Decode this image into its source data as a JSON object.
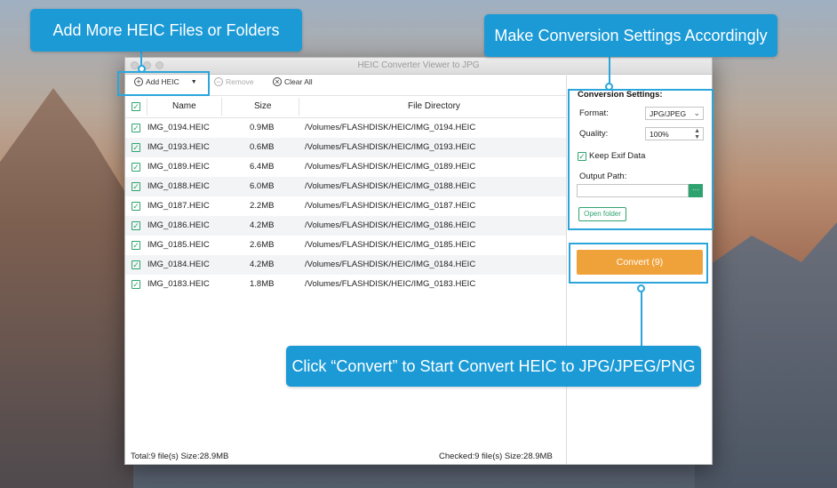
{
  "window": {
    "title": "HEIC Converter Viewer to JPG"
  },
  "toolbar": {
    "add_label": "Add HEIC",
    "remove_label": "Remove",
    "clear_label": "Clear All"
  },
  "table": {
    "headers": {
      "name": "Name",
      "size": "Size",
      "dir": "File Directory"
    },
    "rows": [
      {
        "name": "IMG_0194.HEIC",
        "size": "0.9MB",
        "dir": "/Volumes/FLASHDISK/HEIC/IMG_0194.HEIC"
      },
      {
        "name": "IMG_0193.HEIC",
        "size": "0.6MB",
        "dir": "/Volumes/FLASHDISK/HEIC/IMG_0193.HEIC"
      },
      {
        "name": "IMG_0189.HEIC",
        "size": "6.4MB",
        "dir": "/Volumes/FLASHDISK/HEIC/IMG_0189.HEIC"
      },
      {
        "name": "IMG_0188.HEIC",
        "size": "6.0MB",
        "dir": "/Volumes/FLASHDISK/HEIC/IMG_0188.HEIC"
      },
      {
        "name": "IMG_0187.HEIC",
        "size": "2.2MB",
        "dir": "/Volumes/FLASHDISK/HEIC/IMG_0187.HEIC"
      },
      {
        "name": "IMG_0186.HEIC",
        "size": "4.2MB",
        "dir": "/Volumes/FLASHDISK/HEIC/IMG_0186.HEIC"
      },
      {
        "name": "IMG_0185.HEIC",
        "size": "2.6MB",
        "dir": "/Volumes/FLASHDISK/HEIC/IMG_0185.HEIC"
      },
      {
        "name": "IMG_0184.HEIC",
        "size": "4.2MB",
        "dir": "/Volumes/FLASHDISK/HEIC/IMG_0184.HEIC"
      },
      {
        "name": "IMG_0183.HEIC",
        "size": "1.8MB",
        "dir": "/Volumes/FLASHDISK/HEIC/IMG_0183.HEIC"
      }
    ]
  },
  "status": {
    "total": "Total:9 file(s) Size:28.9MB",
    "checked": "Checked:9 file(s) Size:28.9MB"
  },
  "settings": {
    "title": "Conversion Settings:",
    "format_label": "Format:",
    "format_value": "JPG/JPEG",
    "quality_label": "Quality:",
    "quality_value": "100%",
    "exif_label": "Keep Exif Data",
    "output_label": "Output Path:",
    "output_value": "",
    "browse_label": "···",
    "open_folder": "Open folder",
    "convert": "Convert (9)"
  },
  "callouts": {
    "add": "Add More HEIC Files or Folders",
    "settings": "Make Conversion Settings Accordingly",
    "convert": "Click  “Convert” to Start Convert HEIC to JPG/JPEG/PNG"
  },
  "colors": {
    "accent": "#1b9ad6",
    "convert_button": "#f0a23a",
    "check": "#2ea36f"
  }
}
